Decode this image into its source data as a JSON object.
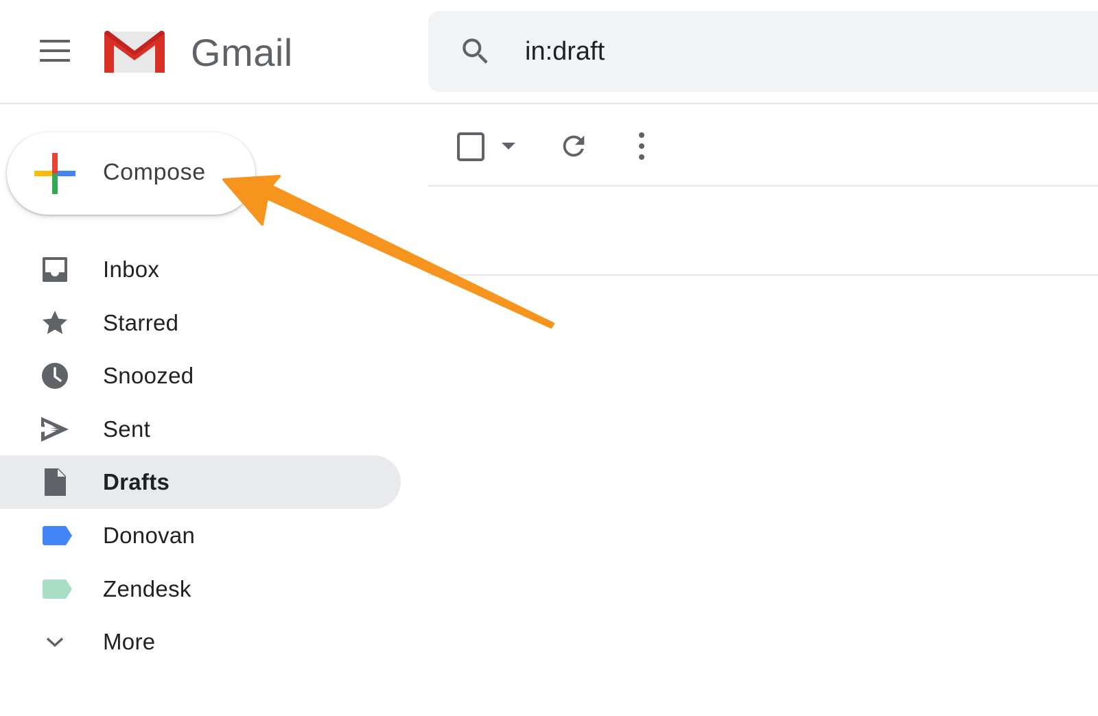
{
  "header": {
    "logo_text": "Gmail",
    "search_query": "in:draft"
  },
  "compose": {
    "label": "Compose"
  },
  "sidebar": {
    "items": [
      {
        "label": "Inbox",
        "icon": "inbox-icon"
      },
      {
        "label": "Starred",
        "icon": "star-icon"
      },
      {
        "label": "Snoozed",
        "icon": "clock-icon"
      },
      {
        "label": "Sent",
        "icon": "send-icon"
      },
      {
        "label": "Drafts",
        "icon": "draft-icon",
        "active": true
      },
      {
        "label": "Donovan",
        "icon": "label-icon",
        "color": "#4285f4"
      },
      {
        "label": "Zendesk",
        "icon": "label-icon",
        "color": "#a8dfc4"
      },
      {
        "label": "More",
        "icon": "chevron-down-icon"
      }
    ]
  },
  "colors": {
    "annotation_arrow": "#f7941d",
    "active_item_bg": "#e8eaed"
  }
}
